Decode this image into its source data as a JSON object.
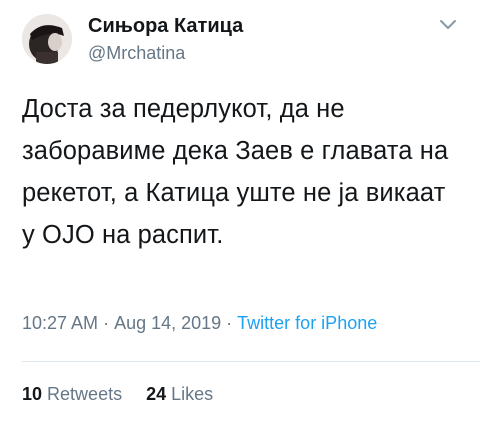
{
  "tweet": {
    "author_name": "Сињора Катица",
    "author_handle": "@Mrchatina",
    "text": "Доста за педерлукот, да не заборавиме дека Заев е главата на рекетот, а Катица уште не ја викаат у ОЈО на распит.",
    "time": "10:27 AM",
    "separator": "·",
    "date": "Aug 14, 2019",
    "source": "Twitter for iPhone",
    "retweets_count": "10",
    "retweets_label": "Retweets",
    "likes_count": "24",
    "likes_label": "Likes"
  },
  "icons": {
    "avatar": "avatar-image",
    "menu": "chevron-down-icon"
  },
  "colors": {
    "text": "#14171a",
    "muted": "#657786",
    "link": "#1da1f2",
    "divider": "#e1e8ed"
  }
}
